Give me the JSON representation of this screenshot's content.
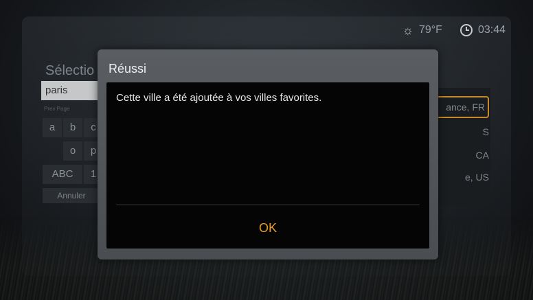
{
  "status": {
    "temperature": "79°F",
    "time": "03:44",
    "weather_icon": "sun-icon",
    "clock_icon": "clock-icon"
  },
  "background": {
    "title": "Sélectio",
    "search_value": "paris",
    "prev_page": "Prev Page",
    "keys": [
      "a",
      "b",
      "c",
      "o",
      "p",
      "ABC",
      "1"
    ],
    "cancel": "Annuler",
    "cities": [
      "ance, FR",
      "S",
      "CA",
      "e, US"
    ]
  },
  "dialog": {
    "title": "Réussi",
    "message": "Cette ville a été ajoutée à vos villes favorites.",
    "ok_label": "OK"
  },
  "colors": {
    "accent": "#e89a2c",
    "dialog_bg": "#50545a",
    "body_bg": "#050505"
  }
}
